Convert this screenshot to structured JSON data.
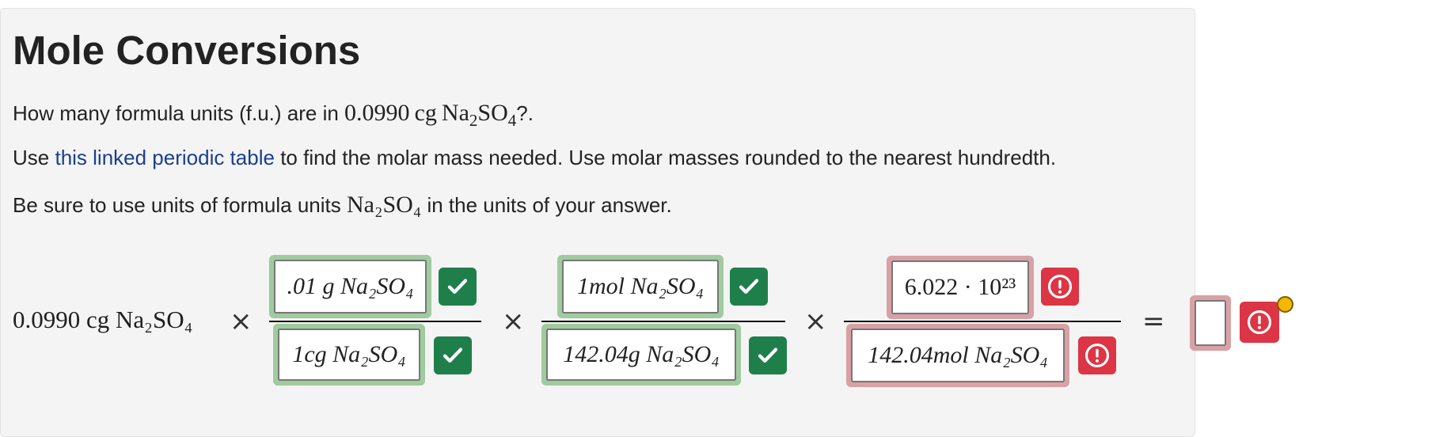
{
  "title": "Mole Conversions",
  "question": {
    "lead": "How many formula units (f.u.) are in ",
    "quantity": "0.0990",
    "unit": "cg",
    "species_base": "Na",
    "species_sub1": "2",
    "species_mid": "SO",
    "species_sub2": "4",
    "tail": "?."
  },
  "instruction": {
    "before": "Use ",
    "link": "this linked periodic table",
    "after": " to find the molar mass needed. Use molar masses rounded to the nearest hundredth."
  },
  "units_note": {
    "before": "Be sure to use units of formula units ",
    "species": "Na₂SO₄",
    "after": " in the units of your answer."
  },
  "given": "0.0990 cg Na₂SO₄",
  "operators": {
    "times": "×",
    "equals": "="
  },
  "fractions": [
    {
      "numerator": {
        "value": ".01 g Na₂SO₄",
        "status": "correct"
      },
      "denominator": {
        "value": "1cg Na₂SO₄",
        "status": "correct"
      }
    },
    {
      "numerator": {
        "value": "1mol Na₂SO₄",
        "status": "correct"
      },
      "denominator": {
        "value": "142.04g Na₂SO₄",
        "status": "correct"
      }
    },
    {
      "numerator": {
        "value": "6.022 · 10²³",
        "status": "incorrect"
      },
      "denominator": {
        "value": "142.04mol Na₂SO₄",
        "status": "incorrect"
      }
    }
  ],
  "answer": {
    "value": "",
    "status": "incorrect"
  },
  "colors": {
    "correct_border": "#9fcb9f",
    "correct_badge": "#1f7f4b",
    "incorrect_border": "#d9a1a5",
    "incorrect_badge": "#dc3545",
    "link": "#1a3f8f",
    "marker": "#f5b800"
  },
  "icons": {
    "correct": "check-icon",
    "incorrect": "exclamation-circle-icon"
  }
}
